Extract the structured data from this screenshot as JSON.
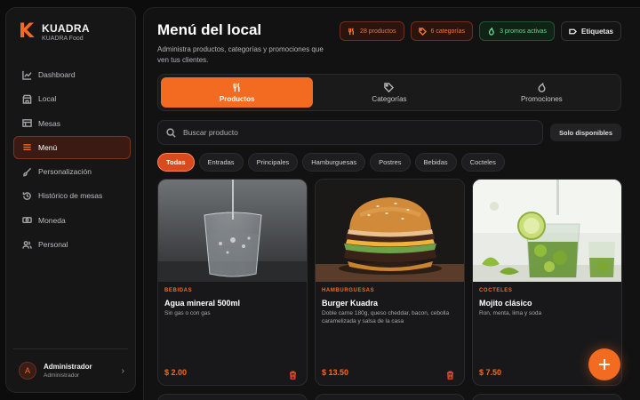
{
  "brand": {
    "logo_letter": "K",
    "name": "KUADRA",
    "subtitle": "KUADRA Food",
    "accent": "#f26b21"
  },
  "sidebar": {
    "items": [
      {
        "label": "Dashboard",
        "icon": "chart-line-icon"
      },
      {
        "label": "Local",
        "icon": "store-icon"
      },
      {
        "label": "Mesas",
        "icon": "table-icon"
      },
      {
        "label": "Menú",
        "icon": "menu-icon",
        "active": true
      },
      {
        "label": "Personalización",
        "icon": "brush-icon"
      },
      {
        "label": "Histórico de mesas",
        "icon": "history-icon"
      },
      {
        "label": "Moneda",
        "icon": "banknote-icon"
      },
      {
        "label": "Personal",
        "icon": "users-icon"
      }
    ],
    "user": {
      "initial": "A",
      "name": "Administrador",
      "role": "Administrador"
    }
  },
  "header": {
    "title": "Menú del local",
    "description": "Administra productos, categorías y promociones que ven tus clientes.",
    "badges": {
      "products": "28 productos",
      "categories": "6 categorías",
      "promos": "3 promos activas",
      "tags": "Etiquetas"
    }
  },
  "tabs": [
    {
      "label": "Productos",
      "icon": "utensils-icon",
      "active": true
    },
    {
      "label": "Categorías",
      "icon": "tag-icon"
    },
    {
      "label": "Promociones",
      "icon": "flame-icon"
    }
  ],
  "search": {
    "placeholder": "Buscar producto",
    "value": ""
  },
  "filter_button": "Solo disponibles",
  "chips": [
    "Todas",
    "Entradas",
    "Principales",
    "Hamburguesas",
    "Postres",
    "Bebidas",
    "Cocteles"
  ],
  "products": [
    {
      "category": "BEBIDAS",
      "name": "Agua mineral 500ml",
      "description": "Sin gas o con gas",
      "price": "$ 2.00",
      "image": "water-glass"
    },
    {
      "category": "HAMBURGUESAS",
      "name": "Burger Kuadra",
      "description": "Doble carne 180g, queso cheddar, bacon, cebolla caramelizada y salsa de la casa",
      "price": "$ 13.50",
      "image": "burger"
    },
    {
      "category": "COCTELES",
      "name": "Mojito clásico",
      "description": "Ron, menta, lima y soda",
      "price": "$ 7.50",
      "image": "mojito"
    }
  ]
}
